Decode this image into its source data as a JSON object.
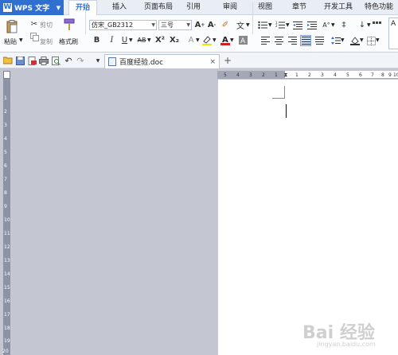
{
  "app": {
    "name": "WPS 文字",
    "logo": "W"
  },
  "ribbon_tabs": [
    "开始",
    "插入",
    "页面布局",
    "引用",
    "审阅",
    "视图",
    "章节",
    "开发工具",
    "特色功能"
  ],
  "active_tab": "开始",
  "clipboard": {
    "paste": "粘贴",
    "cut": "剪切",
    "copy": "复制",
    "format_painter": "格式刷"
  },
  "font": {
    "name": "仿宋_GB2312",
    "size": "三号"
  },
  "format_buttons": {
    "bold": "B",
    "italic": "I",
    "underline": "U",
    "strike": "AB",
    "superscript": "X²",
    "subscript": "X₂"
  },
  "document_tab": {
    "title": "百度经验.doc",
    "close": "×",
    "new": "+"
  },
  "ruler": {
    "horizontal": [
      "5",
      "4",
      "3",
      "2",
      "1",
      "1",
      "2",
      "3",
      "4",
      "5",
      "6",
      "7",
      "8",
      "9",
      "10"
    ],
    "vertical": [
      "1",
      "2",
      "3",
      "4",
      "5",
      "6",
      "7",
      "8",
      "9",
      "10",
      "11",
      "12",
      "13",
      "14",
      "15",
      "16",
      "17",
      "18",
      "19",
      "20"
    ]
  },
  "watermark": "Bai 经验",
  "watermark_sub": "jingyan.baidu.com",
  "colors": {
    "accent": "#2f6fd0",
    "workspace": "#c4c6d1",
    "page": "#ffffff"
  }
}
